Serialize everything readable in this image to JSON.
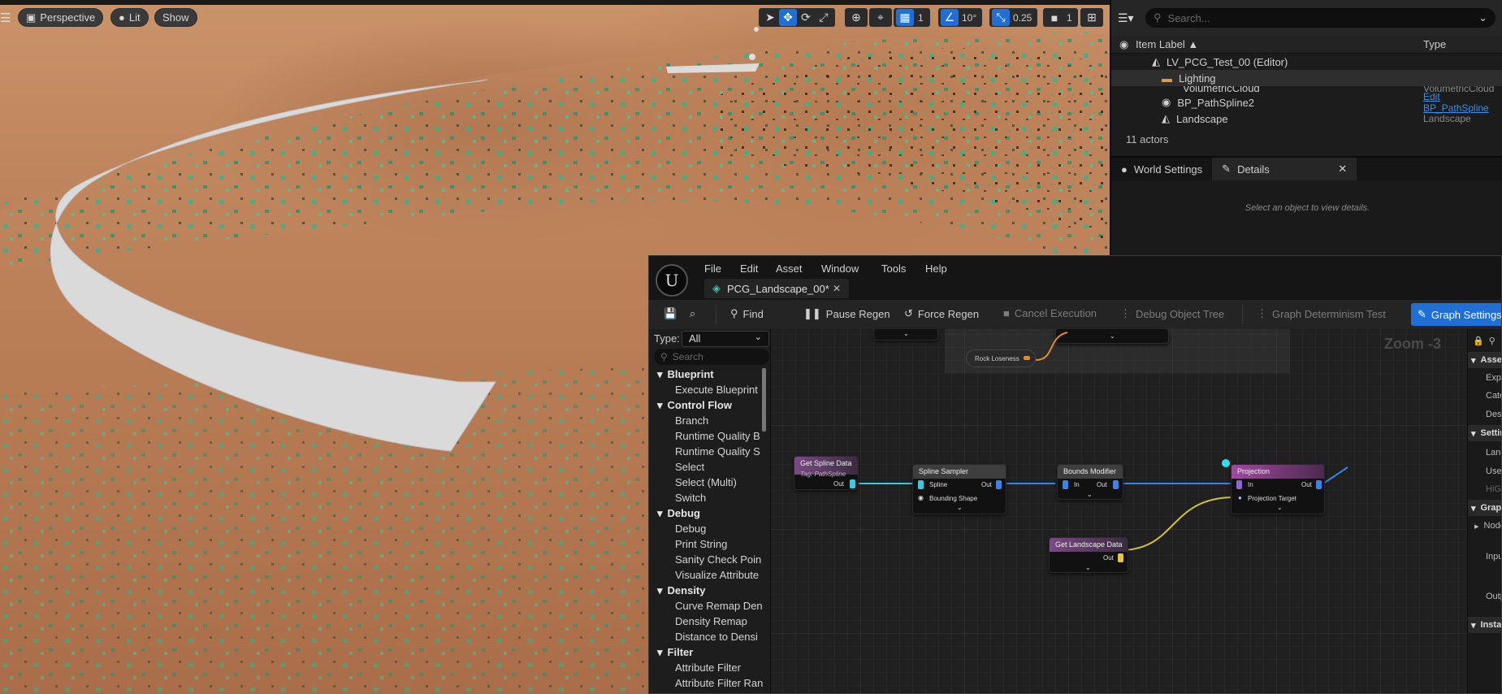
{
  "viewport": {
    "perspective_label": "Perspective",
    "lit_label": "Lit",
    "show_label": "Show",
    "grid_value": "1",
    "angle_value": "10°",
    "scale_value": "0.25",
    "camera_value": "1"
  },
  "outliner": {
    "search_placeholder": "Search...",
    "col_item_label": "Item Label ▲",
    "col_type": "Type",
    "rows": [
      {
        "label": "LV_PCG_Test_00 (Editor)",
        "type": ""
      },
      {
        "label": "Lighting",
        "type": ""
      },
      {
        "label": "VolumetricCloud",
        "type": "VolumetricCloud"
      },
      {
        "label": "BP_PathSpline2",
        "type": "Edit BP_PathSpline"
      },
      {
        "label": "Landscape",
        "type": "Landscape"
      }
    ],
    "actor_count": "11 actors"
  },
  "details": {
    "tab_world_settings": "World Settings",
    "tab_details": "Details",
    "empty_message": "Select an object to view details."
  },
  "pcg": {
    "menu": [
      "File",
      "Edit",
      "Asset",
      "Window",
      "Tools",
      "Help"
    ],
    "doc_tab": "PCG_Landscape_00*",
    "toolbar": {
      "find": "Find",
      "pause_regen": "Pause Regen",
      "force_regen": "Force Regen",
      "cancel_execution": "Cancel Execution",
      "debug_object_tree": "Debug Object Tree",
      "graph_determinism": "Graph Determinism Test",
      "graph_settings": "Graph Settings"
    },
    "palette": {
      "type_label": "Type:",
      "type_value": "All",
      "search_placeholder": "Search",
      "categories": [
        {
          "name": "Blueprint",
          "items": [
            "Execute Blueprint"
          ]
        },
        {
          "name": "Control Flow",
          "items": [
            "Branch",
            "Runtime Quality B",
            "Runtime Quality S",
            "Select",
            "Select (Multi)",
            "Switch"
          ]
        },
        {
          "name": "Debug",
          "items": [
            "Debug",
            "Print String",
            "Sanity Check Poin",
            "Visualize Attribute"
          ]
        },
        {
          "name": "Density",
          "items": [
            "Curve Remap Den",
            "Density Remap",
            "Distance to Densi"
          ]
        },
        {
          "name": "Filter",
          "items": [
            "Attribute Filter",
            "Attribute Filter Ran"
          ]
        }
      ]
    },
    "graph": {
      "zoom": "Zoom -3",
      "rock_node": "Rock Loseness",
      "nodes": {
        "get_spline": {
          "title": "Get Spline Data",
          "tag": "Tag: PathSpline",
          "out": "Out"
        },
        "spline_sampler": {
          "title": "Spline Sampler",
          "in1": "Spline",
          "in2": "Bounding Shape",
          "out": "Out"
        },
        "bounds_modifier": {
          "title": "Bounds Modifier",
          "in": "In",
          "out": "Out"
        },
        "projection": {
          "title": "Projection",
          "in": "In",
          "in2": "Projection Target",
          "out": "Out"
        },
        "get_landscape": {
          "title": "Get Landscape Data",
          "out": "Out"
        }
      }
    },
    "details_panel": {
      "asset_info": "Asset Info",
      "expose": "Expose to L",
      "category": "Category",
      "description": "Description",
      "settings": "Settings",
      "landscape": "Landscape",
      "use_hierarchy": "Use Hierarc",
      "higen": "HiGen Defau",
      "graph": "Graph",
      "nodes": "Nodes",
      "input_node": "Input Node",
      "output_node": "Output Nod",
      "instance": "Instance"
    }
  }
}
